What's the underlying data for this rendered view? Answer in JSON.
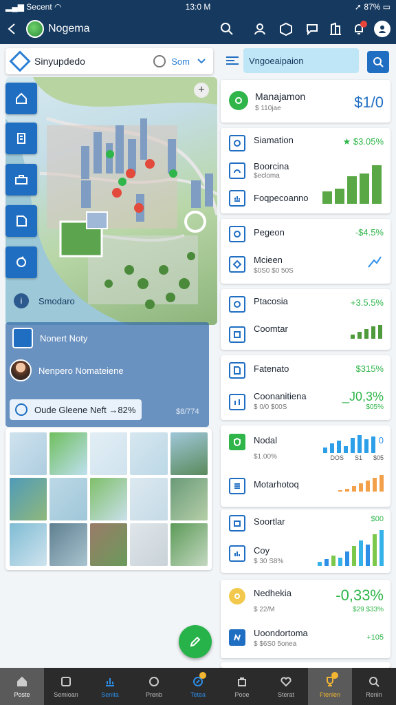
{
  "status_bar": {
    "carrier": "Secent",
    "time": "13:0 M",
    "battery": "87%"
  },
  "app_bar": {
    "title": "Nogema"
  },
  "left_search": {
    "text": "Sinyupdedo",
    "filter_label": "Som"
  },
  "map_panel": {
    "rail_label": "Smodaro",
    "overlay": {
      "title": "Nonert Noty",
      "person": "Nenpero Nomateiene",
      "chip_text": "Oude Gleene Neft →82%",
      "chip_value": "$8/774"
    }
  },
  "right_search": {
    "text": "Vngoeaipaion"
  },
  "cards": [
    {
      "title": "Manajamon",
      "sub": "$ 110jae",
      "value": "$1/0"
    },
    {
      "rows": [
        {
          "title": "Siamation",
          "value": "★ $3.05%"
        },
        {
          "title": "Boorcina",
          "sub": "$ecloma"
        },
        {
          "title": "Foqpecoanno"
        }
      ],
      "chart": [
        18,
        22,
        40,
        44,
        56
      ]
    },
    {
      "rows": [
        {
          "title": "Pegeon",
          "value": "-$4.5%"
        },
        {
          "title": "Mcieen",
          "sub": "$0S0 $0 50S"
        }
      ]
    },
    {
      "rows": [
        {
          "title": "Ptacosia",
          "value": "+3.5.5%"
        },
        {
          "title": "Coomtar"
        }
      ],
      "chart": [
        6,
        10,
        14,
        18,
        20
      ]
    },
    {
      "rows": [
        {
          "title": "Fatenato",
          "value": "$315%"
        },
        {
          "title": "Coonanitiena",
          "sub": "$ 0/0 $00S",
          "value": "_J0,3%",
          "value2": "$05%"
        }
      ]
    },
    {
      "rows": [
        {
          "title": "Nodal",
          "sub": "$1.00%",
          "value": "0"
        },
        {
          "title": "Motarhotoq"
        }
      ],
      "chart_labels": [
        "DOS",
        "S1",
        "$05"
      ],
      "chart_blue": [
        8,
        14,
        18,
        10,
        22,
        26,
        20,
        24
      ],
      "chart_orange": [
        2,
        4,
        8,
        12,
        16,
        20,
        24
      ]
    },
    {
      "rows": [
        {
          "title": "Soortlar",
          "value": "$00"
        },
        {
          "title": "Coy",
          "sub": "$ 30 S8%"
        }
      ],
      "chart": [
        6,
        10,
        14,
        12,
        20,
        28,
        36,
        30,
        44,
        50
      ]
    },
    {
      "rows": [
        {
          "title": "Nedhekia",
          "sub": "$ 22/M",
          "value": "-0,33%",
          "value2": "$29 $33%"
        },
        {
          "title": "Uoondortoma",
          "sub": "$ $6S0 5onea",
          "value": "+105"
        }
      ]
    }
  ],
  "bottom_nav": [
    {
      "label": "Poste"
    },
    {
      "label": "Semioan"
    },
    {
      "label": "Senita"
    },
    {
      "label": "Prenb"
    },
    {
      "label": "Tetea"
    },
    {
      "label": "Pooe"
    },
    {
      "label": "Sterat"
    },
    {
      "label": "Ftenlen"
    },
    {
      "label": "Renin"
    }
  ],
  "colors": {
    "primary": "#1f6ec2",
    "appbar": "#15395f",
    "positive": "#2fb54a",
    "accent": "#f2b632"
  }
}
